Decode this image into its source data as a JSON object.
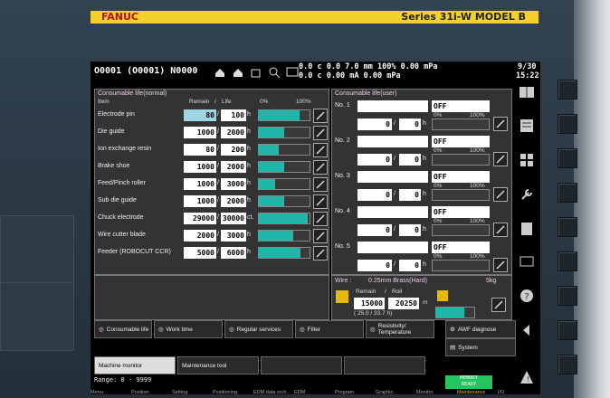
{
  "brand": {
    "logo": "FANUC",
    "model": "Series 31i-W MODEL B"
  },
  "header": {
    "program": "O0001 (O0001) N0000",
    "status_line1": "0.0 c  0.0 7.0 mm  100% 0.00 mPa",
    "status_line2": "0.0 c  0.00 mA  0.00 mPa",
    "date": "9/30",
    "time": "15:22"
  },
  "normal": {
    "title": "Consumable life(normal)",
    "col_item": "Item",
    "col_remain": "Remain",
    "col_slash": "/",
    "col_life": "Life",
    "col_0": "0%",
    "col_100": "100%",
    "rows": [
      {
        "name": "Electrode pin",
        "remain": "80",
        "life": "100",
        "unit": "h",
        "pct": 0.8
      },
      {
        "name": "Die guide",
        "remain": "1000",
        "life": "2000",
        "unit": "h",
        "pct": 0.5
      },
      {
        "name": "Ion exchange resin",
        "remain": "80",
        "life": "200",
        "unit": "h",
        "pct": 0.4
      },
      {
        "name": "Brake shoe",
        "remain": "1000",
        "life": "2000",
        "unit": "h",
        "pct": 0.5
      },
      {
        "name": "Feed/Pinch roller",
        "remain": "1000",
        "life": "3000",
        "unit": "h",
        "pct": 0.33
      },
      {
        "name": "Sub die guide",
        "remain": "1000",
        "life": "2000",
        "unit": "h",
        "pct": 0.5
      },
      {
        "name": "Chuck electrode",
        "remain": "29000",
        "life": "30000",
        "unit": "ct.",
        "pct": 0.97
      },
      {
        "name": "Wire cutter blade",
        "remain": "2000",
        "life": "3000",
        "unit": "h",
        "pct": 0.67
      },
      {
        "name": "Feeder (ROBOCUT CCR)",
        "remain": "5000",
        "life": "6000",
        "unit": "h",
        "pct": 0.83
      }
    ]
  },
  "user": {
    "title": "Consumable life(user)",
    "rows": [
      {
        "no": "No. 1",
        "state": "OFF",
        "remain": "0",
        "life": "0",
        "unit": "h",
        "p0": "0%",
        "p100": "100%"
      },
      {
        "no": "No. 2",
        "state": "OFF",
        "remain": "0",
        "life": "0",
        "unit": "h",
        "p0": "0%",
        "p100": "100%"
      },
      {
        "no": "No. 3",
        "state": "OFF",
        "remain": "0",
        "life": "0",
        "unit": "h",
        "p0": "0%",
        "p100": "100%"
      },
      {
        "no": "No. 4",
        "state": "OFF",
        "remain": "0",
        "life": "0",
        "unit": "h",
        "p0": "0%",
        "p100": "100%"
      },
      {
        "no": "No. 5",
        "state": "OFF",
        "remain": "0",
        "life": "0",
        "unit": "h",
        "p0": "0%",
        "p100": "100%"
      }
    ]
  },
  "wire": {
    "label": "Wire :",
    "spec": "0.25mm  Brass(Hard)",
    "weight": "5kg",
    "col_remain": "Remain",
    "col_roll": "Roll",
    "remain": "15000",
    "roll": "20250",
    "unit": "m",
    "sub": "( 25.0 /   33.7 h)",
    "pct": 0.74
  },
  "tabs1": [
    {
      "label": "Consumable life",
      "icon": "lifebuoy-icon"
    },
    {
      "label": "Work time",
      "icon": "stopwatch-icon"
    },
    {
      "label": "Regular services",
      "icon": "wrench-icon"
    },
    {
      "label": "Filter",
      "icon": "filter-icon"
    },
    {
      "label": "Resistivity/ Temperature",
      "icon": "thermometer-icon"
    },
    {
      "label": "AWF diagnose",
      "icon": "awf-icon"
    }
  ],
  "tabs1_extra": {
    "label": "System",
    "icon": "system-icon"
  },
  "tabs2": [
    {
      "label": "Machine monitor"
    },
    {
      "label": "Maintenance tool"
    }
  ],
  "range": "Range: 0 - 9999",
  "memory": {
    "label": "MEMORY",
    "state": "READY"
  },
  "menu": [
    "Menu",
    "Position",
    "Setting",
    "Positioning",
    "EDM data srch.",
    "EDM",
    "Program",
    "Graphic",
    "Monitor",
    "Maintenance",
    "I/O"
  ]
}
